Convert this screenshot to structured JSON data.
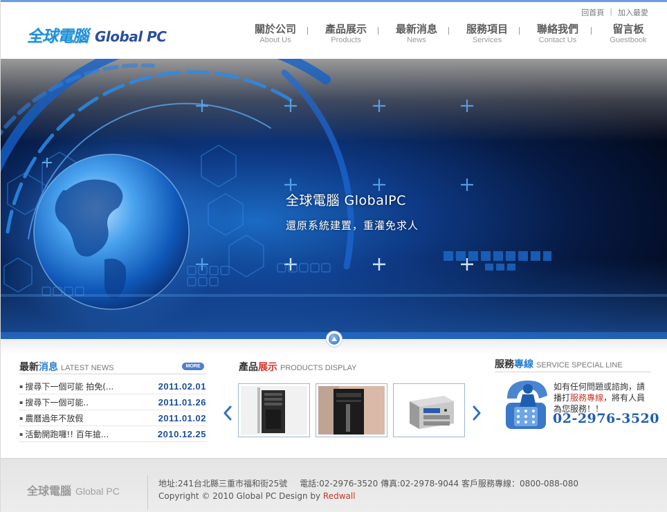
{
  "header": {
    "logo_cn": "全球電腦",
    "logo_en": "Global PC",
    "toplinks": {
      "home": "回首頁",
      "separator": "|",
      "favorite": "加入最愛"
    },
    "nav": [
      {
        "cn": "關於公司",
        "en": "About Us"
      },
      {
        "cn": "產品展示",
        "en": "Products"
      },
      {
        "cn": "最新消息",
        "en": "News"
      },
      {
        "cn": "服務項目",
        "en": "Services"
      },
      {
        "cn": "聯絡我們",
        "en": "Contact Us"
      },
      {
        "cn": "留言板",
        "en": "Guestbook"
      }
    ]
  },
  "banner": {
    "title": "全球電腦  GlobalPC",
    "subtitle": "還原系統建置，重灌免求人"
  },
  "news": {
    "title_a": "最新",
    "title_b": "消息",
    "title_en": "LATEST NEWS",
    "more": "MORE",
    "items": [
      {
        "title": "搜尋下一個可能 拍免(...",
        "date": "2011.02.01"
      },
      {
        "title": "搜尋下一個可能..",
        "date": "2011.01.26"
      },
      {
        "title": "農曆過年不放假",
        "date": "2011.01.02"
      },
      {
        "title": "活動開跑囉!! 百年搶...",
        "date": "2010.12.25"
      }
    ]
  },
  "products": {
    "title_a": "產品",
    "title_b": "展示",
    "title_en": "PRODUCTS DISPLAY",
    "items": [
      {
        "icon": "tower-case-image"
      },
      {
        "icon": "black-case-image"
      },
      {
        "icon": "silver-nas-image"
      }
    ]
  },
  "service": {
    "title_a": "服務",
    "title_b": "專線",
    "title_en": "SERVICE SPECIAL LINE",
    "text_a": "如有任何問題或諮詢，請播打",
    "text_highlight": "服務專線",
    "text_b": "，將有人員為您服務！！",
    "phone": "02-2976-3520"
  },
  "footer": {
    "logo_cn": "全球電腦",
    "logo_en": "Global PC",
    "address": "地址:241台北縣三重市福和街25號",
    "contact": "電話:02-2976-3520 傳真:02-2978-9044 客戶服務專線：0800-088-080",
    "copyright": "Copyright © 2010 Global PC Design by ",
    "brand": "Redwall"
  },
  "colors": {
    "accent": "#2d7fd2",
    "highlight_red": "#d8332a",
    "date_blue": "#1a4f9a",
    "banner_dark": "#03091c",
    "top_bar": "#6d9de0"
  }
}
